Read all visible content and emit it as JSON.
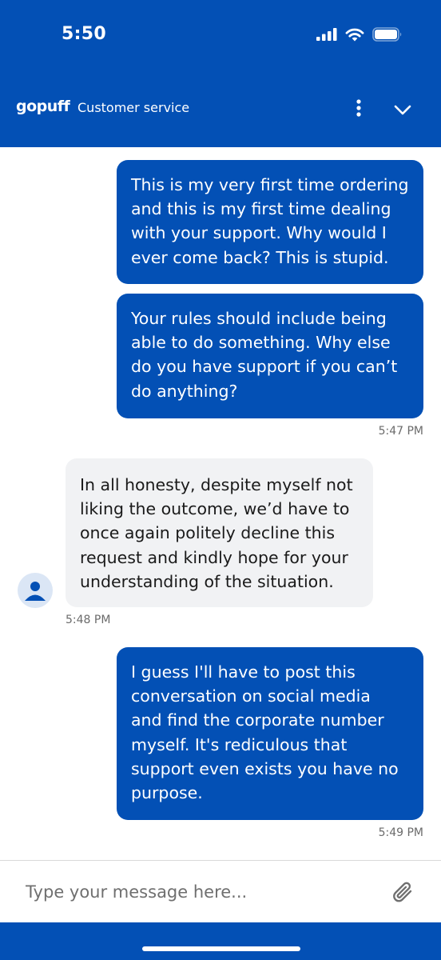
{
  "status_bar": {
    "time": "5:50"
  },
  "header": {
    "brand": "gopuff",
    "title": "Customer service"
  },
  "messages": [
    {
      "direction": "outgoing",
      "lines": [
        "This is my very first time ordering",
        "and this is my first time dealing",
        "with your support. Why would I",
        "ever come back? This is stupid."
      ]
    },
    {
      "direction": "outgoing",
      "lines": [
        "Your rules should include being",
        "able to do something. Why else",
        "do you have support if you can’t",
        "do anything?"
      ],
      "time": "5:47 PM"
    },
    {
      "direction": "incoming",
      "lines": [
        "In all honesty, despite myself not",
        "liking the outcome, we’d have to",
        "once again politely decline this",
        "request and kindly hope for your",
        "understanding of the situation."
      ],
      "time": "5:48 PM"
    },
    {
      "direction": "outgoing",
      "lines": [
        "I guess I'll have to post this",
        "conversation on social media",
        "and find the corporate number",
        "myself. It's rediculous that",
        "support even exists you have no",
        "purpose."
      ],
      "time": "5:49 PM"
    }
  ],
  "composer": {
    "placeholder": "Type your message here..."
  },
  "colors": {
    "brand_blue": "#0350b5",
    "incoming_bubble": "#f1f2f4",
    "timestamp": "#6b6b6b"
  },
  "icons": [
    "signal-icon",
    "wifi-icon",
    "battery-icon",
    "more-vertical-icon",
    "chevron-down-icon",
    "avatar-person-icon",
    "paperclip-icon"
  ]
}
